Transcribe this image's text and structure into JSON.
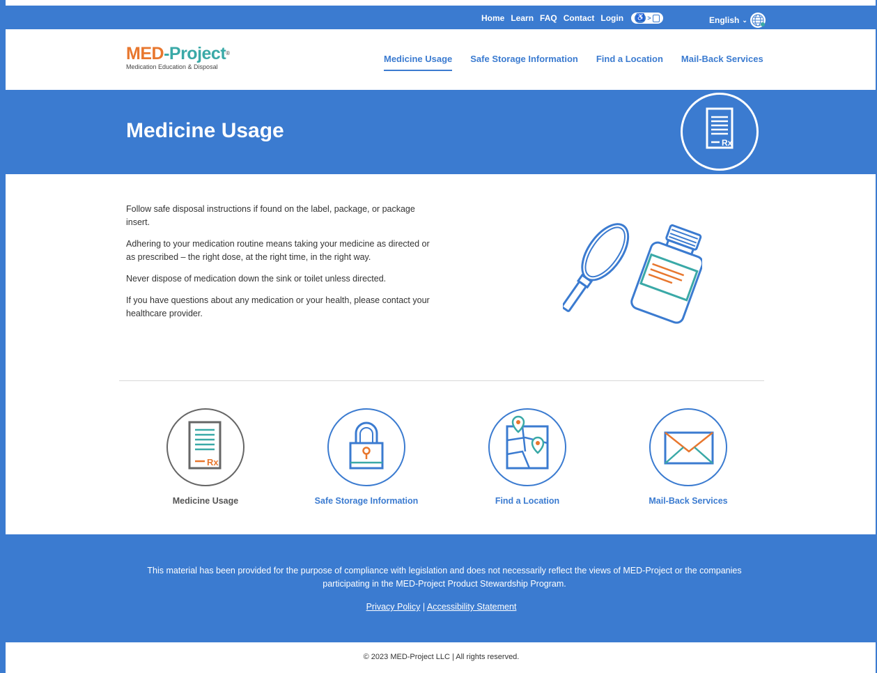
{
  "utility_bar": {
    "links": [
      "Home",
      "Learn",
      "FAQ",
      "Contact",
      "Login"
    ],
    "language": "English"
  },
  "logo": {
    "name_part1": "MED",
    "name_part2": "-Project",
    "trademark": "®",
    "tagline": "Medication Education & Disposal"
  },
  "main_nav": [
    {
      "label": "Medicine Usage",
      "active": true
    },
    {
      "label": "Safe Storage Information",
      "active": false
    },
    {
      "label": "Find a Location",
      "active": false
    },
    {
      "label": "Mail-Back Services",
      "active": false
    }
  ],
  "hero": {
    "title": "Medicine Usage",
    "icon": "prescription-document-icon"
  },
  "content": {
    "paragraphs": [
      "Follow safe disposal instructions if found on the label, package, or package insert.",
      "Adhering to your medication routine means taking your medicine as directed or as prescribed – the right dose, at the right time, in the right way.",
      "Never dispose of medication down the sink or toilet unless directed.",
      "If you have questions about any medication or your health, please contact your healthcare provider."
    ],
    "illustration": "magnifier-and-pill-bottle-icon"
  },
  "cards": [
    {
      "label": "Medicine Usage",
      "icon": "prescription-document-icon",
      "active": true
    },
    {
      "label": "Safe Storage Information",
      "icon": "padlock-icon",
      "active": false
    },
    {
      "label": "Find a Location",
      "icon": "map-pins-icon",
      "active": false
    },
    {
      "label": "Mail-Back Services",
      "icon": "envelope-icon",
      "active": false
    }
  ],
  "footer": {
    "disclaimer": "This material has been provided for the purpose of compliance with legislation and does not necessarily reflect the views of MED-Project or the companies participating in the MED-Project Product Stewardship Program.",
    "privacy_link": "Privacy Policy",
    "separator": "|",
    "accessibility_link": "Accessibility Statement",
    "copyright": "©  2023 MED-Project LLC | All rights reserved."
  },
  "colors": {
    "primary_blue": "#3b7bd0",
    "brand_orange": "#e8772e",
    "brand_teal": "#3aa9a7"
  }
}
